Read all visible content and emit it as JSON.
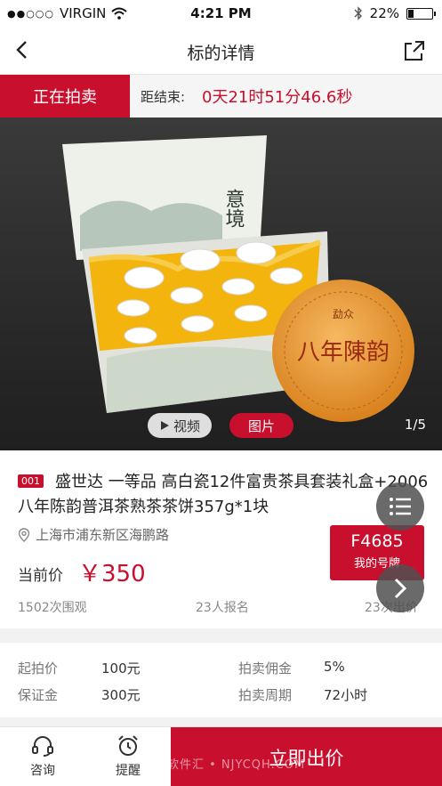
{
  "status_bar": {
    "signal_dots": "●●○○○",
    "carrier": "VIRGIN",
    "time": "4:21 PM",
    "battery_text": "22%",
    "battery_level": 0.22
  },
  "nav": {
    "title": "标的详情"
  },
  "auction": {
    "status_tag": "正在拍卖",
    "countdown_label": "距结束:",
    "countdown_value": "0天21时51分46.6秒"
  },
  "gallery": {
    "video_label": "视频",
    "photo_label": "图片",
    "pager": "1/5",
    "box_text": "意境",
    "cake_brand": "勐众",
    "cake_text": "八年陳韵"
  },
  "product": {
    "lot_no": "001",
    "title": "盛世达 一等品 高白瓷12件富贵茶具套装礼盒+2006八年陈韵普洱茶熟茶茶饼357g*1块",
    "location": "上海市浦东新区海鹏路",
    "price_label": "当前价",
    "price": "￥350",
    "views": "1502次围观",
    "signups": "23人报名",
    "bids": "23次出价"
  },
  "bidder": {
    "number": "F4685",
    "label": "我的号牌"
  },
  "terms": {
    "start_price_label": "起拍价",
    "start_price": "100元",
    "deposit_label": "保证金",
    "deposit": "300元",
    "commission_label": "拍卖佣金",
    "commission": "5%",
    "period_label": "拍卖周期",
    "period": "72小时"
  },
  "bottom_bar": {
    "consult_label": "咨询",
    "remind_label": "提醒",
    "bid_label": "立即出价",
    "watermark": "南京软件汇 • NJYCQH.COM"
  },
  "colors": {
    "accent": "#c8102e",
    "tea_orange": "#e8952a",
    "fab_gray": "#505050"
  }
}
